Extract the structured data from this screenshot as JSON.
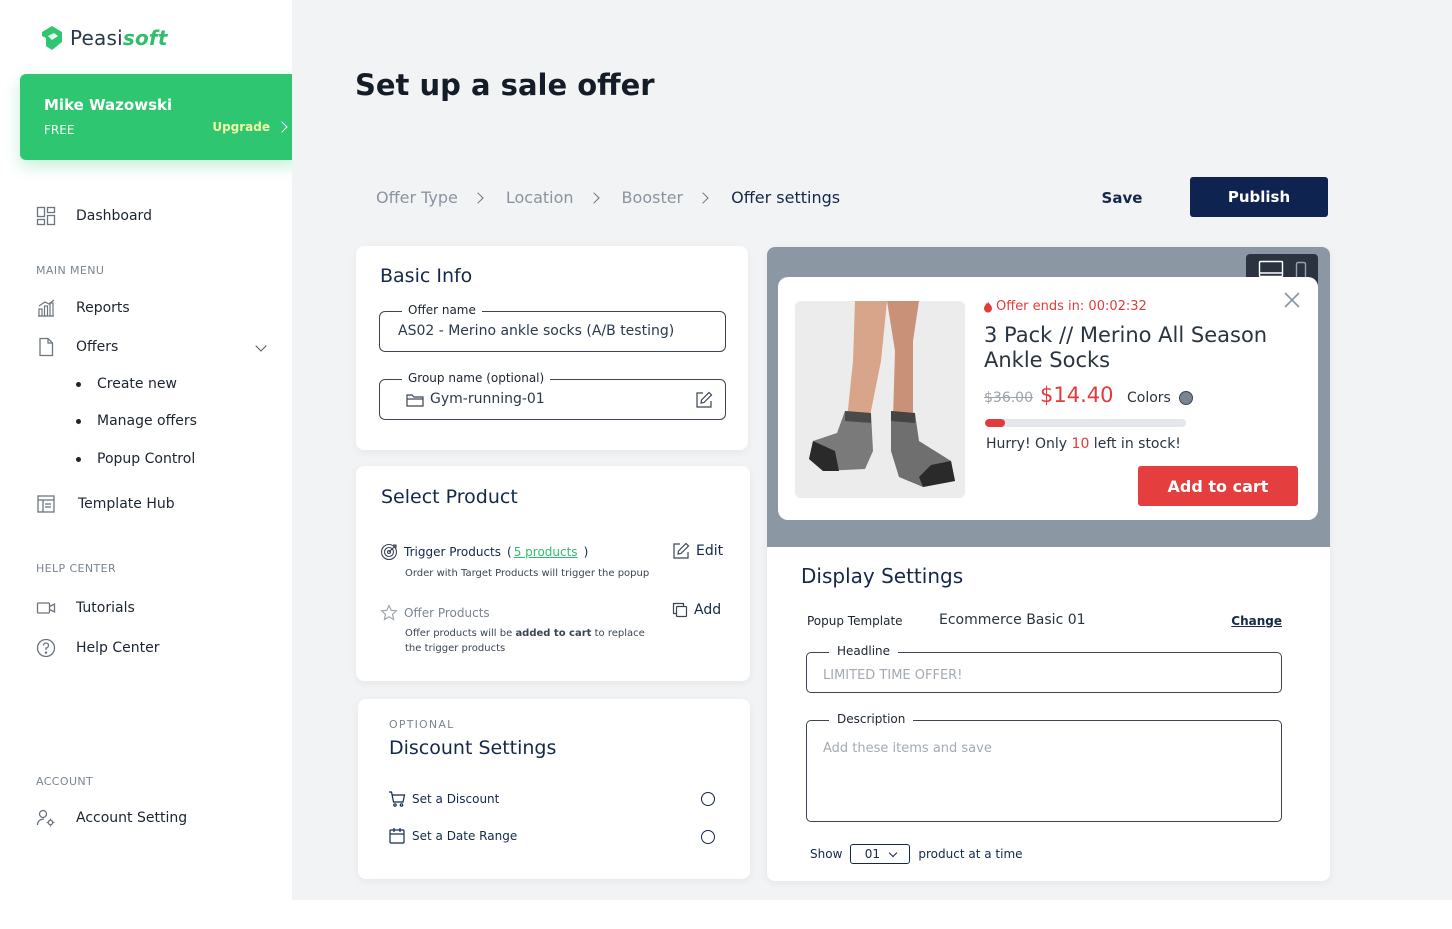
{
  "brand": {
    "logo_main": "Peasi",
    "logo_accent": "soft"
  },
  "user": {
    "name": "Mike Wazowski",
    "plan": "FREE",
    "upgrade_label": "Upgrade"
  },
  "sidebar": {
    "dashboard": "Dashboard",
    "main_menu_label": "MAIN MENU",
    "reports": "Reports",
    "offers": "Offers",
    "offers_sub": [
      "Create new",
      "Manage offers",
      "Popup Control"
    ],
    "template_hub": "Template Hub",
    "help_center_label": "HELP CENTER",
    "tutorials": "Tutorials",
    "help_center": "Help Center",
    "account_label": "ACCOUNT",
    "account_setting": "Account Setting"
  },
  "page": {
    "title": "Set up a sale offer"
  },
  "breadcrumb": [
    "Offer Type",
    "Location",
    "Booster",
    "Offer settings"
  ],
  "toolbar": {
    "save_label": "Save",
    "publish_label": "Publish"
  },
  "basic_info": {
    "title": "Basic Info",
    "offer_name_label": "Offer name",
    "offer_name_value": "AS02 - Merino ankle socks (A/B testing)",
    "group_name_label": "Group name (optional)",
    "group_name_value": "Gym-running-01"
  },
  "select_product": {
    "title": "Select Product",
    "trigger_title": "Trigger Products",
    "trigger_open": "(",
    "trigger_count": "5 products",
    "trigger_close": ")",
    "trigger_desc": "Order with Target Products will trigger the popup",
    "edit_label": "Edit",
    "offer_title": "Offer Products",
    "offer_desc_1": "Offer products will be ",
    "offer_desc_bold": "added to cart",
    "offer_desc_2": " to replace",
    "offer_desc_3": "the trigger products",
    "add_label": "Add"
  },
  "discount": {
    "optional_label": "OPTIONAL",
    "title": "Discount Settings",
    "set_discount": "Set a Discount",
    "set_date_range": "Set a Date Range"
  },
  "preview": {
    "timer_label": "Offer ends in: 00:02:32",
    "product_title": "3 Pack // Merino All Season Ankle Socks",
    "old_price": "$36.00",
    "new_price": "$14.40",
    "colors_label": "Colors",
    "color_swatch": "#7b8591",
    "stock_fraction": 0.1,
    "stock_text_1": "Hurry! Only ",
    "stock_count": "10",
    "stock_text_2": " left in stock!",
    "cart_label": "Add to cart"
  },
  "display_settings": {
    "title": "Display Settings",
    "template_label": "Popup Template",
    "template_value": "Ecommerce Basic 01",
    "change_label": "Change",
    "headline_label": "Headline",
    "headline_placeholder": "LIMITED TIME  OFFER!",
    "description_label": "Description",
    "description_placeholder": "Add these items and save",
    "show_label": "Show",
    "show_value": "01",
    "show_suffix": "product at a time"
  },
  "colors": {
    "accent_green": "#2fc672",
    "navy": "#0f2350",
    "red": "#e43e3e"
  }
}
